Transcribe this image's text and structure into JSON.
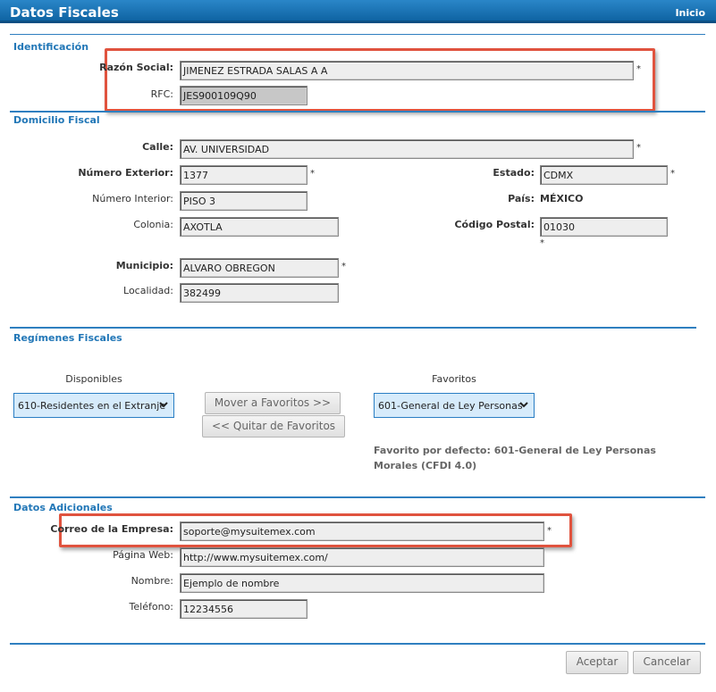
{
  "header": {
    "title": "Datos Fiscales",
    "home_link": "Inicio"
  },
  "identificacion": {
    "title": "Identificación",
    "razon_social_label": "Razón Social:",
    "razon_social_value": "JIMENEZ ESTRADA SALAS A A",
    "rfc_label": "RFC:",
    "rfc_value": "JES900109Q90"
  },
  "domicilio": {
    "title": "Domicilio Fiscal",
    "calle_label": "Calle:",
    "calle_value": "AV. UNIVERSIDAD",
    "num_ext_label": "Número Exterior:",
    "num_ext_value": "1377",
    "num_int_label": "Número Interior:",
    "num_int_value": "PISO 3",
    "colonia_label": "Colonia:",
    "colonia_value": "AXOTLA",
    "estado_label": "Estado:",
    "estado_value": "CDMX",
    "pais_label": "País:",
    "pais_value": "MÉXICO",
    "cp_label": "Código Postal:",
    "cp_value": "01030",
    "municipio_label": "Municipio:",
    "municipio_value": "ALVARO OBREGON",
    "localidad_label": "Localidad:",
    "localidad_value": "382499"
  },
  "regimenes": {
    "title": "Regímenes Fiscales",
    "disponibles_label": "Disponibles",
    "disponibles_selected": "610-Residentes en el Extranje",
    "favoritos_label": "Favoritos",
    "favoritos_selected": "601-General de Ley Personas",
    "mover_button": "Mover a Favoritos >>",
    "quitar_button": "<< Quitar de Favoritos",
    "favorito_defecto": "Favorito por defecto: 601-General de Ley Personas Morales (CFDI 4.0)"
  },
  "adicionales": {
    "title": "Datos Adicionales",
    "correo_label": "Correo de la Empresa:",
    "correo_value": "soporte@mysuitemex.com",
    "web_label": "Página Web:",
    "web_value": "http://www.mysuitemex.com/",
    "nombre_label": "Nombre:",
    "nombre_value": "Ejemplo de nombre",
    "telefono_label": "Teléfono:",
    "telefono_value": "12234556"
  },
  "required_mark": "*",
  "footer": {
    "accept_button": "Aceptar",
    "cancel_button": "Cancelar"
  },
  "colors": {
    "accent": "#1a6fb0",
    "highlight": "#e0533e"
  }
}
